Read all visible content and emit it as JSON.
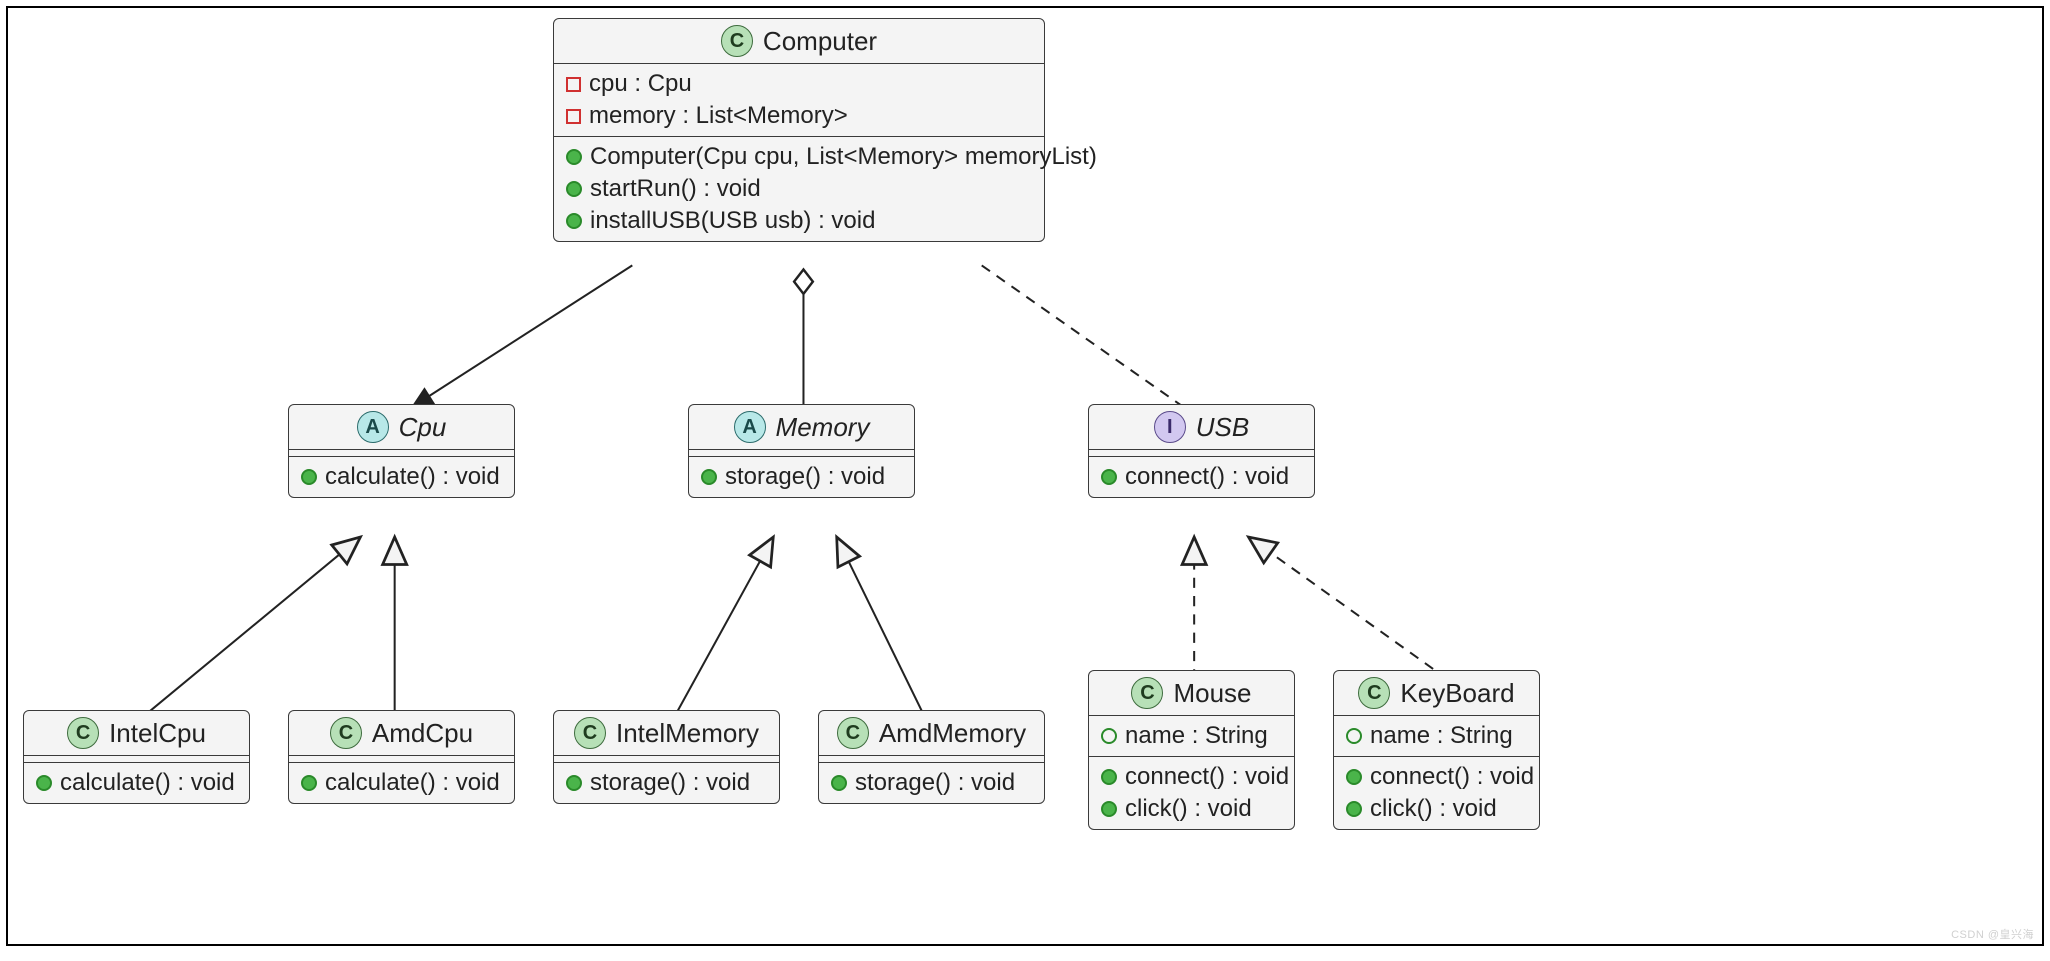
{
  "classes": {
    "computer": {
      "name": "Computer",
      "badge": "C",
      "fields": [
        {
          "vis": "private-field",
          "text": "cpu : Cpu"
        },
        {
          "vis": "private-field",
          "text": "memory : List<Memory>"
        }
      ],
      "methods": [
        {
          "vis": "public-method",
          "text": "Computer(Cpu cpu, List<Memory> memoryList)"
        },
        {
          "vis": "public-method",
          "text": "startRun() : void"
        },
        {
          "vis": "public-method",
          "text": "installUSB(USB usb) : void"
        }
      ]
    },
    "cpu": {
      "name": "Cpu",
      "badge": "A",
      "italic": true,
      "methods": [
        {
          "vis": "public-method",
          "text": "calculate() : void"
        }
      ]
    },
    "memory": {
      "name": "Memory",
      "badge": "A",
      "italic": true,
      "methods": [
        {
          "vis": "public-method",
          "text": "storage() : void"
        }
      ]
    },
    "usb": {
      "name": "USB",
      "badge": "I",
      "italic": true,
      "methods": [
        {
          "vis": "public-method",
          "text": "connect() : void"
        }
      ]
    },
    "intelCpu": {
      "name": "IntelCpu",
      "badge": "C",
      "methods": [
        {
          "vis": "public-method",
          "text": "calculate() : void"
        }
      ]
    },
    "amdCpu": {
      "name": "AmdCpu",
      "badge": "C",
      "methods": [
        {
          "vis": "public-method",
          "text": "calculate() : void"
        }
      ]
    },
    "intelMemory": {
      "name": "IntelMemory",
      "badge": "C",
      "methods": [
        {
          "vis": "public-method",
          "text": "storage() : void"
        }
      ]
    },
    "amdMemory": {
      "name": "AmdMemory",
      "badge": "C",
      "methods": [
        {
          "vis": "public-method",
          "text": "storage() : void"
        }
      ]
    },
    "mouse": {
      "name": "Mouse",
      "badge": "C",
      "fields": [
        {
          "vis": "public-field",
          "text": "name : String"
        }
      ],
      "methods": [
        {
          "vis": "public-method",
          "text": "connect() : void"
        },
        {
          "vis": "public-method",
          "text": "click() : void"
        }
      ]
    },
    "keyboard": {
      "name": "KeyBoard",
      "badge": "C",
      "fields": [
        {
          "vis": "public-field",
          "text": "name : String"
        }
      ],
      "methods": [
        {
          "vis": "public-method",
          "text": "connect() : void"
        },
        {
          "vis": "public-method",
          "text": "click() : void"
        }
      ]
    }
  },
  "watermark": "CSDN @皇兴海"
}
